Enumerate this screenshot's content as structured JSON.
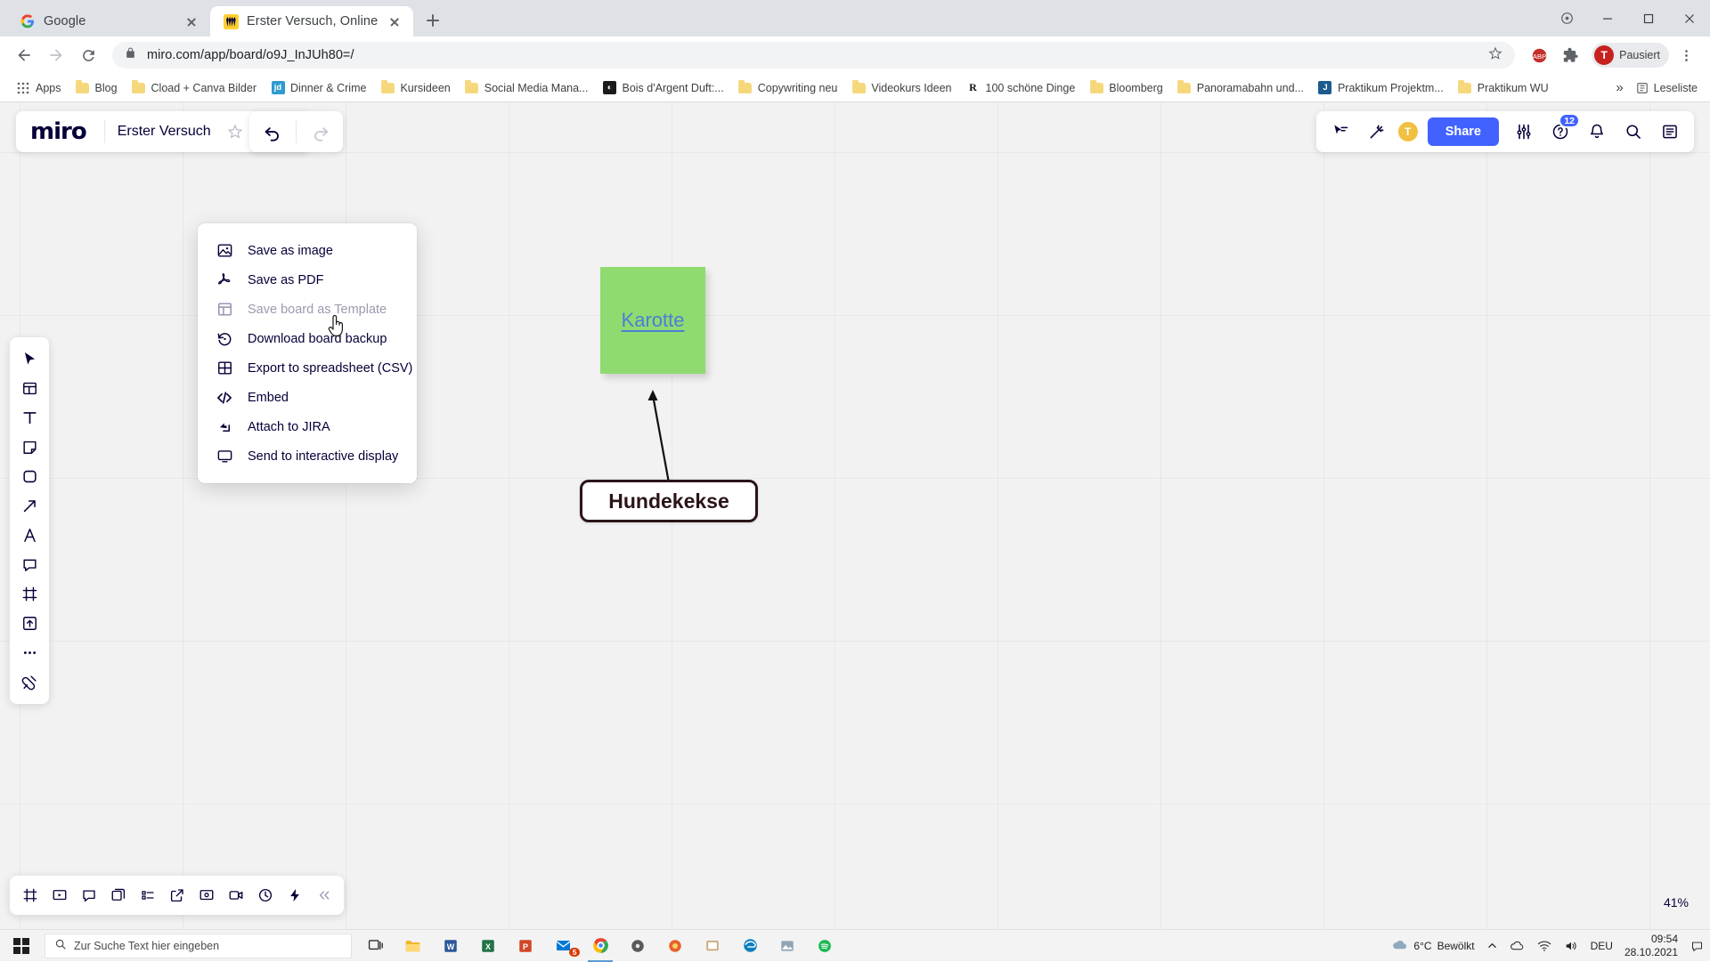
{
  "browser": {
    "tabs": [
      {
        "title": "Google",
        "favicon": "google-icon",
        "active": false
      },
      {
        "title": "Erster Versuch, Online Whiteboa",
        "favicon": "miro-icon",
        "active": true
      }
    ],
    "newtab_label": "+",
    "omnibox": {
      "url": "miro.com/app/board/o9J_InJUh80=/",
      "lock_icon": "lock-icon",
      "star_icon": "star-icon"
    },
    "nav": {
      "back": "back-icon",
      "forward": "forward-icon",
      "reload": "reload-icon"
    },
    "profile": {
      "initial": "T",
      "label": "Pausiert"
    },
    "extensions_icon": "extensions-icon",
    "menu_icon": "three-dot-menu-icon",
    "cast_icon": "cast-icon",
    "apps_label": "Apps",
    "bookmarks": [
      {
        "label": "Blog",
        "icon": "folder"
      },
      {
        "label": "Cload + Canva Bilder",
        "icon": "folder"
      },
      {
        "label": "Dinner & Crime",
        "icon": "square",
        "glyph": "jd",
        "color": "#2e9ad0"
      },
      {
        "label": "Kursideen",
        "icon": "folder"
      },
      {
        "label": "Social Media Mana...",
        "icon": "folder"
      },
      {
        "label": "Bois d'Argent Duft:...",
        "icon": "square",
        "glyph": "◐",
        "color": "#1b1b1b"
      },
      {
        "label": "Copywriting neu",
        "icon": "folder"
      },
      {
        "label": "Videokurs Ideen",
        "icon": "folder"
      },
      {
        "label": "100 schöne Dinge",
        "icon": "square",
        "glyph": "R",
        "color": "#ffffff",
        "text_color": "#111111"
      },
      {
        "label": "Bloomberg",
        "icon": "folder"
      },
      {
        "label": "Panoramabahn und...",
        "icon": "folder"
      },
      {
        "label": "Praktikum Projektm...",
        "icon": "square",
        "glyph": "J",
        "color": "#1d5b8f"
      },
      {
        "label": "Praktikum WU",
        "icon": "folder"
      }
    ],
    "overflow_label": "»",
    "readinglist_label": "Leseliste"
  },
  "miro": {
    "logo": "miro",
    "board_name": "Erster Versuch",
    "star_icon": "star-outline-icon",
    "export_icon": "upload-export-icon",
    "undo_icon": "undo-icon",
    "redo_icon": "redo-icon",
    "export_menu": {
      "items": [
        {
          "label": "Save as image",
          "icon": "image-icon",
          "disabled": false
        },
        {
          "label": "Save as PDF",
          "icon": "pdf-icon",
          "disabled": false
        },
        {
          "label": "Save board as Template",
          "icon": "template-layout-icon",
          "disabled": true
        },
        {
          "label": "Download board backup",
          "icon": "restore-backup-icon",
          "disabled": false
        },
        {
          "label": "Export to spreadsheet (CSV)",
          "icon": "grid-table-icon",
          "disabled": false
        },
        {
          "label": "Embed",
          "icon": "code-embed-icon",
          "disabled": false
        },
        {
          "label": "Attach to JIRA",
          "icon": "jira-icon",
          "disabled": false
        },
        {
          "label": "Send to interactive display",
          "icon": "display-icon",
          "disabled": false
        }
      ]
    },
    "toolbar_items": [
      {
        "name": "select-cursor-tool",
        "icon": "cursor-arrow-icon"
      },
      {
        "name": "templates-tool",
        "icon": "template-icon"
      },
      {
        "name": "text-tool",
        "icon": "text-t-icon"
      },
      {
        "name": "sticky-note-tool",
        "icon": "sticky-note-icon"
      },
      {
        "name": "shapes-tool",
        "icon": "shape-circle-icon"
      },
      {
        "name": "connector-tool",
        "icon": "arrow-diagonal-icon"
      },
      {
        "name": "pen-tool",
        "icon": "pen-icon"
      },
      {
        "name": "comment-tool",
        "icon": "comment-icon"
      },
      {
        "name": "frame-tool",
        "icon": "frame-icon"
      },
      {
        "name": "upload-tool",
        "icon": "upload-box-icon"
      },
      {
        "name": "more-tools",
        "icon": "ellipsis-icon"
      },
      {
        "name": "apps-tool",
        "icon": "plug-icon"
      }
    ],
    "bottom_items": [
      {
        "name": "frames-panel",
        "icon": "frames-icon"
      },
      {
        "name": "presentation-mode",
        "icon": "presentation-icon"
      },
      {
        "name": "comments-panel",
        "icon": "comment-bubble-icon"
      },
      {
        "name": "cards-panel",
        "icon": "cards-icon"
      },
      {
        "name": "table-panel",
        "icon": "table-list-icon"
      },
      {
        "name": "share-screen",
        "icon": "share-external-icon"
      },
      {
        "name": "screen-share",
        "icon": "screen-icon"
      },
      {
        "name": "video-chat",
        "icon": "video-camera-icon"
      },
      {
        "name": "timer",
        "icon": "timer-icon"
      },
      {
        "name": "quick-actions",
        "icon": "lightning-icon"
      },
      {
        "name": "collapse-bar",
        "icon": "collapse-chevrons-icon"
      }
    ],
    "zoom_level": "41%",
    "topright": {
      "cursor_chat_icon": "cursor-chat-icon",
      "magic_icon": "magic-wand-icon",
      "user_initial": "T",
      "share_label": "Share",
      "settings_icon": "sliders-icon",
      "help_icon": "help-circle-icon",
      "notifications_icon": "bell-icon",
      "notification_count": "12",
      "search_icon": "search-icon",
      "panel_icon": "right-panel-icon"
    },
    "canvas": {
      "sticky_note": {
        "text": "Karotte",
        "color": "#8fdb70",
        "text_color": "#4a7fd4"
      },
      "shape_box": {
        "text": "Hundekekse",
        "border_color": "#2b1418",
        "fill": "#ffffff"
      },
      "connector": {
        "name": "arrow-connector"
      }
    }
  },
  "taskbar": {
    "start_icon": "windows-start-icon",
    "search_placeholder": "Zur Suche Text hier eingeben",
    "search_icon": "search-icon",
    "apps": [
      {
        "name": "task-view",
        "icon": "task-view-icon",
        "color": "#3a3a3a"
      },
      {
        "name": "file-explorer",
        "icon": "folder-icon",
        "color": "#f0b429"
      },
      {
        "name": "word",
        "icon": "word-icon",
        "color": "#2b579a"
      },
      {
        "name": "excel",
        "icon": "excel-icon",
        "color": "#217346"
      },
      {
        "name": "powerpoint",
        "icon": "powerpoint-icon",
        "color": "#d24726"
      },
      {
        "name": "mail",
        "icon": "mail-icon",
        "color": "#0078d4",
        "badge": "5"
      },
      {
        "name": "chrome",
        "icon": "chrome-icon",
        "color": "#4285f4"
      },
      {
        "name": "disc",
        "icon": "disc-icon",
        "color": "#5a5a5a"
      },
      {
        "name": "firefox-alt",
        "icon": "browser-icon",
        "color": "#e8622c"
      },
      {
        "name": "paint",
        "icon": "paint-icon",
        "color": "#c4a36a"
      },
      {
        "name": "edge",
        "icon": "edge-icon",
        "color": "#0f7ebf"
      },
      {
        "name": "photos",
        "icon": "photos-icon",
        "color": "#8a8a8a"
      },
      {
        "name": "spotify",
        "icon": "spotify-icon",
        "color": "#1db954"
      }
    ],
    "weather": {
      "temp": "6°C",
      "desc": "Bewölkt",
      "icon": "cloud-icon"
    },
    "tray": {
      "chevron": "^",
      "onedrive_icon": "cloud-icon",
      "network_icon": "network-icon",
      "volume_icon": "volume-icon",
      "language": "DEU"
    },
    "clock": {
      "time": "09:54",
      "date": "28.10.2021"
    },
    "notification_icon": "notification-icon"
  }
}
